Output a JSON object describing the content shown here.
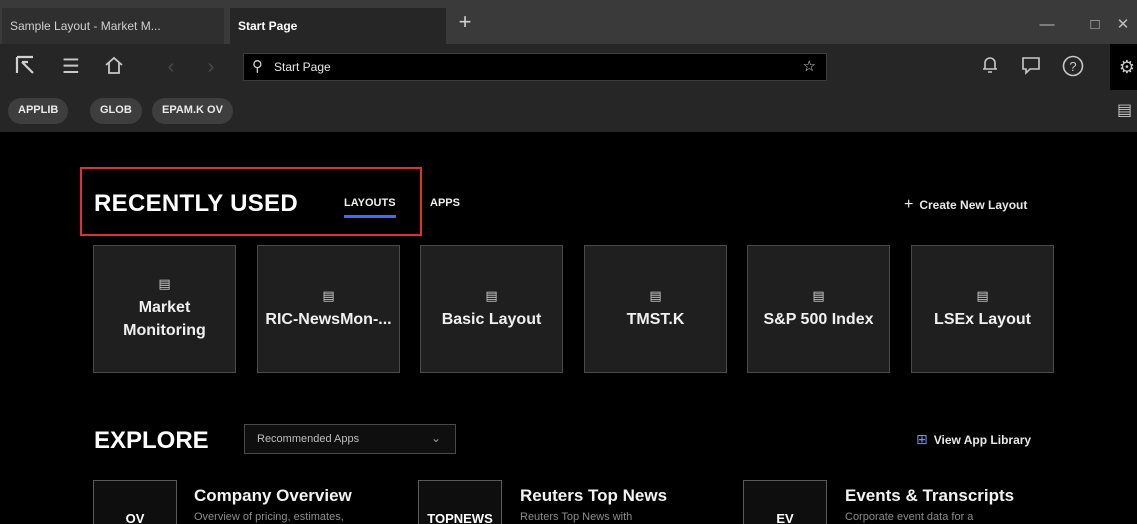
{
  "tabs": [
    {
      "label": "Sample Layout - Market M..."
    },
    {
      "label": "Start Page"
    }
  ],
  "new_tab_icon": "plus-icon",
  "window_controls": [
    "minimize-icon",
    "maximize-icon",
    "close-icon"
  ],
  "toolbar": {
    "icons": [
      "app-logo-icon",
      "menu-icon",
      "home-icon",
      "back-icon",
      "forward-icon"
    ],
    "search": {
      "value": "Start Page",
      "placeholder": "",
      "icon": "search-icon",
      "favorite_icon": "star-icon"
    },
    "right_icons": [
      "bell-icon",
      "chat-icon",
      "help-icon",
      "gear-icon"
    ]
  },
  "quick_links": [
    "APPLIB",
    "GLOB",
    "EPAM.K OV"
  ],
  "recently_used": {
    "title": "RECENTLY USED",
    "tabs": [
      "LAYOUTS",
      "APPS"
    ],
    "selected_tab": "LAYOUTS",
    "create_label": "Create New Layout",
    "layouts": [
      {
        "label": "Market Monitoring"
      },
      {
        "label": "RIC-NewsMon-..."
      },
      {
        "label": "Basic Layout"
      },
      {
        "label": "TMST.K"
      },
      {
        "label": "S&P 500 Index"
      },
      {
        "label": "LSEx Layout"
      }
    ]
  },
  "explore": {
    "title": "EXPLORE",
    "dropdown_value": "Recommended Apps",
    "view_library_label": "View App Library",
    "apps": [
      {
        "code": "OV",
        "name": "Company Overview",
        "desc": "Overview of pricing, estimates,"
      },
      {
        "code": "TOPNEWS",
        "name": "Reuters Top News",
        "desc": "Reuters Top News with"
      },
      {
        "code": "EV",
        "name": "Events & Transcripts",
        "desc": "Corporate event data for a"
      }
    ]
  },
  "colors": {
    "accent": "#3b6bff",
    "highlight_border": "#e03131",
    "background": "#000000"
  }
}
